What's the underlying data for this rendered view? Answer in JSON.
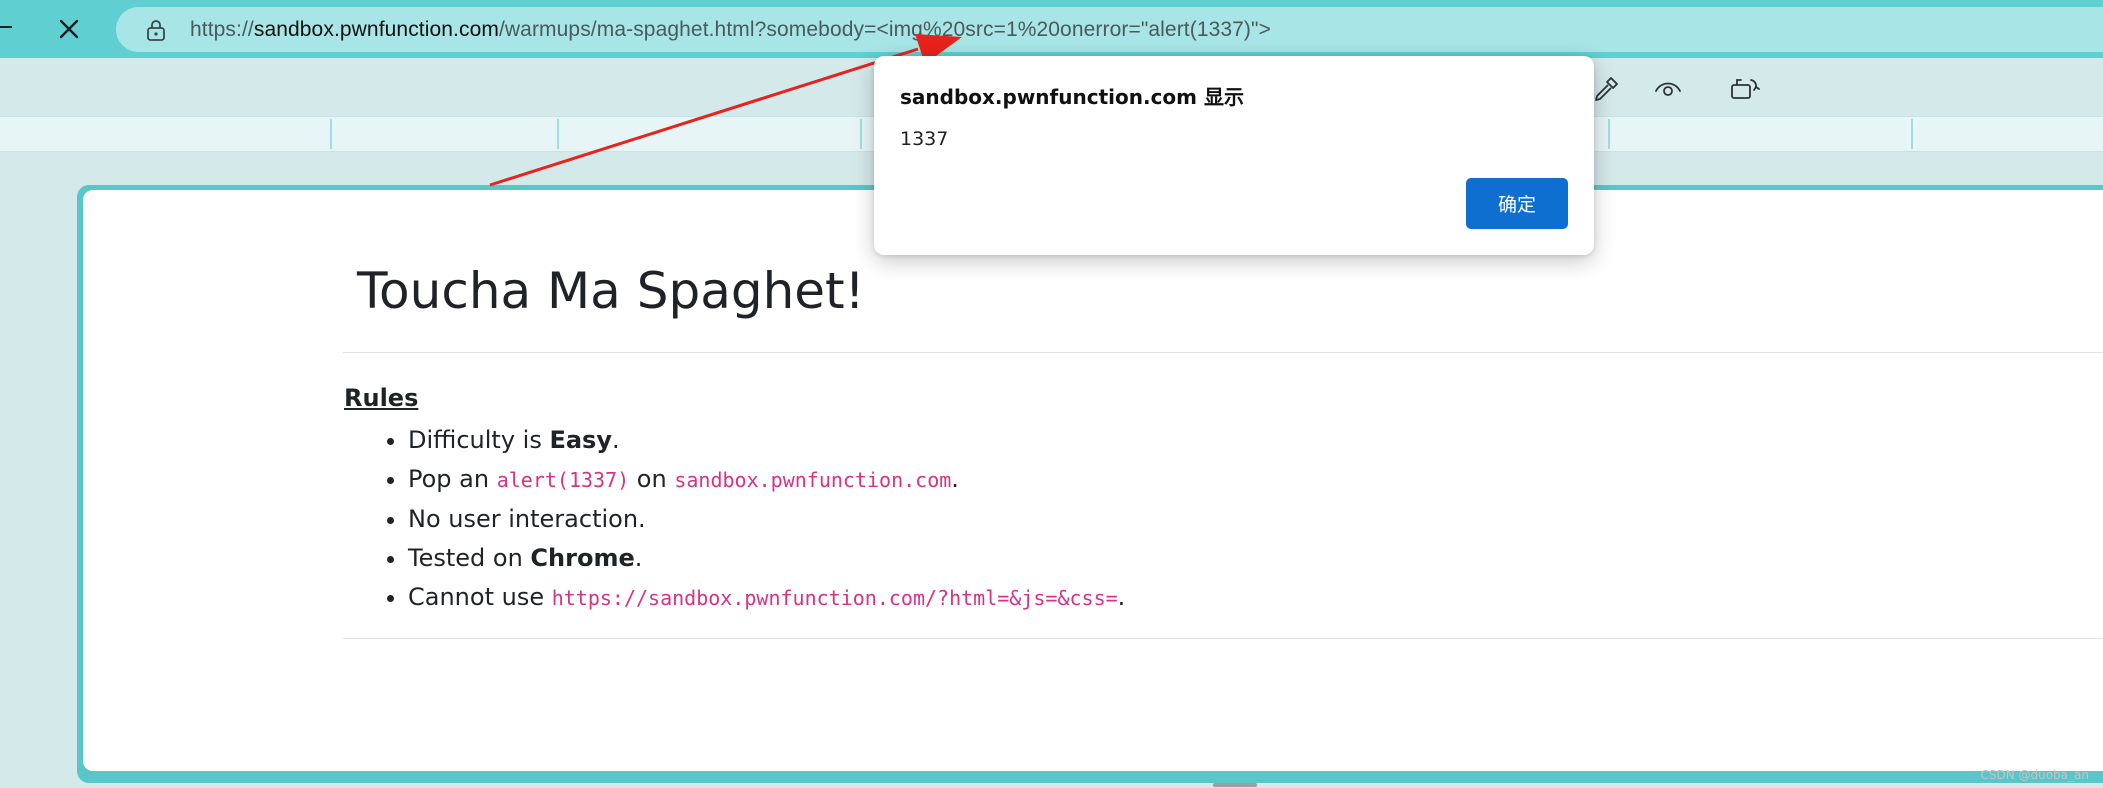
{
  "browser": {
    "url_prefix": "https://",
    "url_host": "sandbox.pwnfunction.com",
    "url_path": "/warmups/ma-spaghet.html?somebody=<img%20src=1%20onerror=\"alert(1337)\">",
    "close_icon": "close-icon",
    "lock_icon": "lock-icon"
  },
  "toolbar": {
    "icons": [
      "eyedropper-icon",
      "eye-icon",
      "screen-capture-icon"
    ]
  },
  "page": {
    "title": "Toucha Ma Spaghet!",
    "rules_heading": "Rules",
    "rules": {
      "difficulty_prefix": "Difficulty is ",
      "difficulty_value": "Easy",
      "difficulty_suffix": ".",
      "pop_prefix": "Pop an ",
      "pop_code": "alert(1337)",
      "pop_middle": " on ",
      "pop_domain": "sandbox.pwnfunction.com",
      "pop_suffix": ".",
      "no_interaction": "No user interaction.",
      "tested_prefix": "Tested on ",
      "tested_value": "Chrome",
      "tested_suffix": ".",
      "cannot_prefix": "Cannot use ",
      "cannot_code": "https://sandbox.pwnfunction.com/?html=&js=&css=",
      "cannot_suffix": "."
    }
  },
  "dialog": {
    "title": "sandbox.pwnfunction.com 显示",
    "message": "1337",
    "ok_label": "确定"
  },
  "watermark": "CSDN @duoba_an",
  "colors": {
    "topbar": "#5fcfd2",
    "urlbar": "#a8e5e6",
    "page_border": "#5bc6ca",
    "code_pink": "#d63384",
    "ok_button": "#0f6fd0",
    "annotation_arrow": "#e8221c"
  }
}
